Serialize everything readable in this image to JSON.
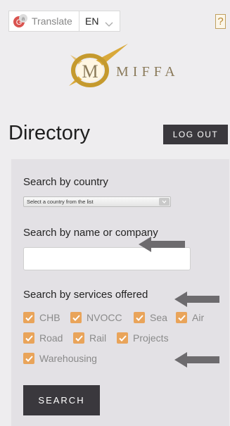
{
  "header": {
    "translate_label": "Translate",
    "language": "EN",
    "help_glyph": "?",
    "icons": [
      "google-translate-icon",
      "chevron-down-icon",
      "help-icon"
    ]
  },
  "logo": {
    "initial": "M",
    "name": "MIFFA",
    "colors": {
      "gold": "#c59a2e",
      "text": "#8a7a5a"
    }
  },
  "page": {
    "title": "Directory",
    "logout_label": "LOG OUT"
  },
  "search": {
    "country_label": "Search by country",
    "country_select_value": "Select a country from the list",
    "name_label": "Search by name or company",
    "name_value": "",
    "services_label": "Search by services offered",
    "services": [
      {
        "label": "CHB",
        "checked": true
      },
      {
        "label": "NVOCC",
        "checked": true
      },
      {
        "label": "Sea",
        "checked": true
      },
      {
        "label": "Air",
        "checked": true
      },
      {
        "label": "Road",
        "checked": true
      },
      {
        "label": "Rail",
        "checked": true
      },
      {
        "label": "Projects",
        "checked": true
      },
      {
        "label": "Warehousing",
        "checked": true
      }
    ],
    "submit_label": "SEARCH"
  },
  "colors": {
    "background": "#eeedef",
    "panel": "#e3e1e5",
    "button_dark": "#3a383d",
    "checkbox_orange": "#e9a45a",
    "annotation_arrow": "#6d6b6e"
  }
}
